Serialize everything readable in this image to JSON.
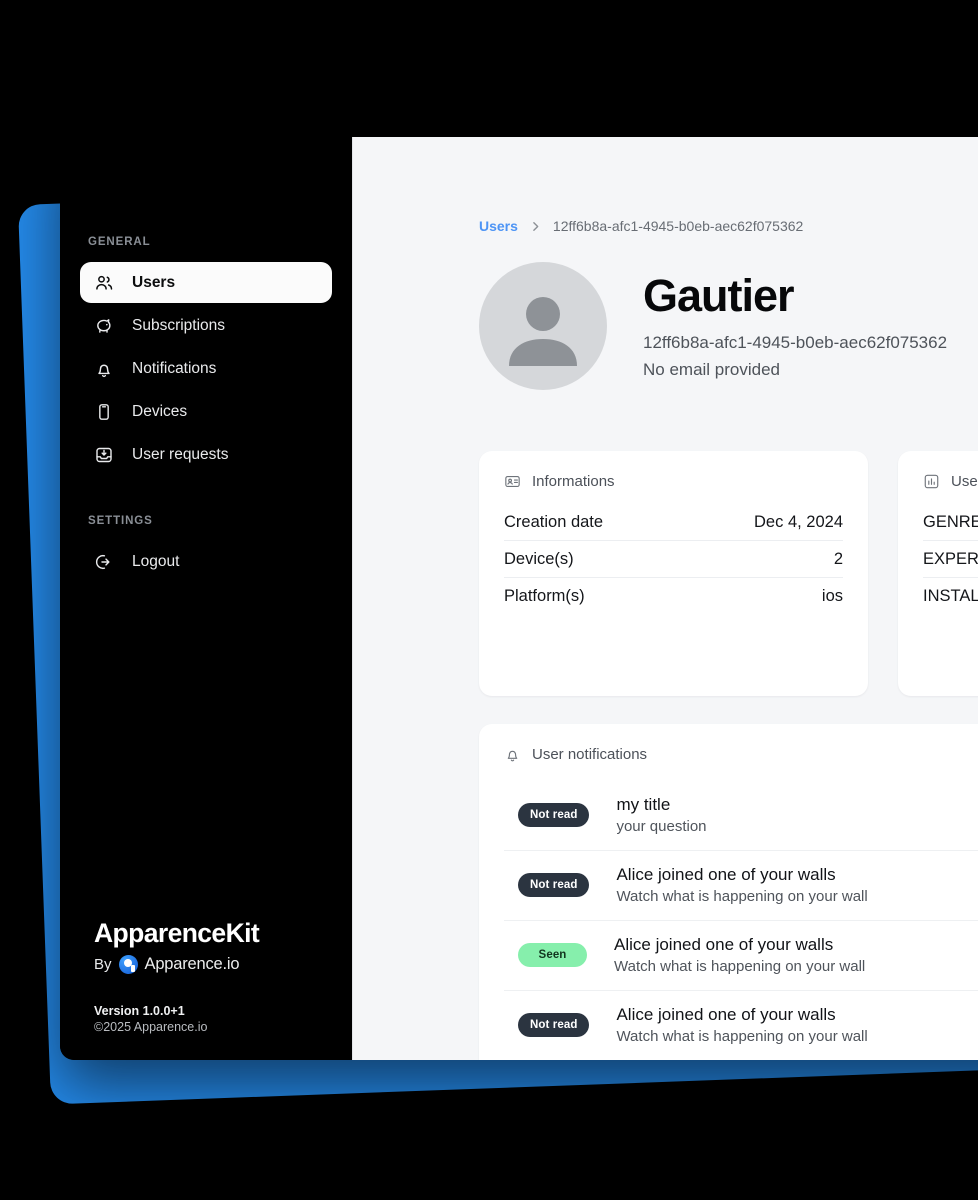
{
  "sidebar": {
    "sections": [
      {
        "label": "GENERAL"
      },
      {
        "label": "SETTINGS"
      }
    ],
    "general_items": [
      {
        "label": "Users",
        "icon": "users-icon",
        "active": true
      },
      {
        "label": "Subscriptions",
        "icon": "piggy-bank-icon",
        "active": false
      },
      {
        "label": "Notifications",
        "icon": "bell-icon",
        "active": false
      },
      {
        "label": "Devices",
        "icon": "mobile-device-icon",
        "active": false
      },
      {
        "label": "User requests",
        "icon": "inbox-download-icon",
        "active": false
      }
    ],
    "settings_items": [
      {
        "label": "Logout",
        "icon": "logout-icon",
        "active": false
      }
    ],
    "brand": {
      "title": "ApparenceKit",
      "by_prefix": "By",
      "company": "Apparence.io",
      "version": "Version 1.0.0+1",
      "copyright": "©2025 Apparence.io"
    }
  },
  "breadcrumb": {
    "root": "Users",
    "separator": "chevron-right-icon",
    "current": "12ff6b8a-afc1-4945-b0eb-aec62f075362"
  },
  "user": {
    "name": "Gautier",
    "id": "12ff6b8a-afc1-4945-b0eb-aec62f075362",
    "email": "No email provided",
    "avatar_icon": "person-placeholder-icon"
  },
  "informations_card": {
    "icon": "contact-card-icon",
    "title": "Informations",
    "rows": [
      {
        "key": "Creation date",
        "value": "Dec 4, 2024"
      },
      {
        "key": "Device(s)",
        "value": "2"
      },
      {
        "key": "Platform(s)",
        "value": "ios"
      }
    ]
  },
  "overview_card": {
    "icon": "bar-chart-icon",
    "title": "User overview",
    "rows": [
      {
        "key": "GENRE",
        "value": ""
      },
      {
        "key": "EXPERIENCE",
        "value": ""
      },
      {
        "key": "INSTALLS",
        "value": ""
      }
    ]
  },
  "notifications_card": {
    "icon": "bell-icon",
    "title": "User notifications",
    "rows": [
      {
        "status": "Not read",
        "state": "unread",
        "title": "my title",
        "subtitle": "your question"
      },
      {
        "status": "Not read",
        "state": "unread",
        "title": "Alice joined one of your walls",
        "subtitle": "Watch what is happening on your wall"
      },
      {
        "status": "Seen",
        "state": "seen",
        "title": "Alice joined one of your walls",
        "subtitle": "Watch what is happening on your wall"
      },
      {
        "status": "Not read",
        "state": "unread",
        "title": "Alice joined one of your walls",
        "subtitle": "Watch what is happening on your wall"
      }
    ]
  },
  "colors": {
    "accent_blue": "#2489E8",
    "link_blue": "#4d94f5",
    "sidebar_bg": "#000000",
    "content_bg": "#f5f6f8",
    "badge_unread": "#2b3440",
    "badge_seen": "#86efac"
  }
}
